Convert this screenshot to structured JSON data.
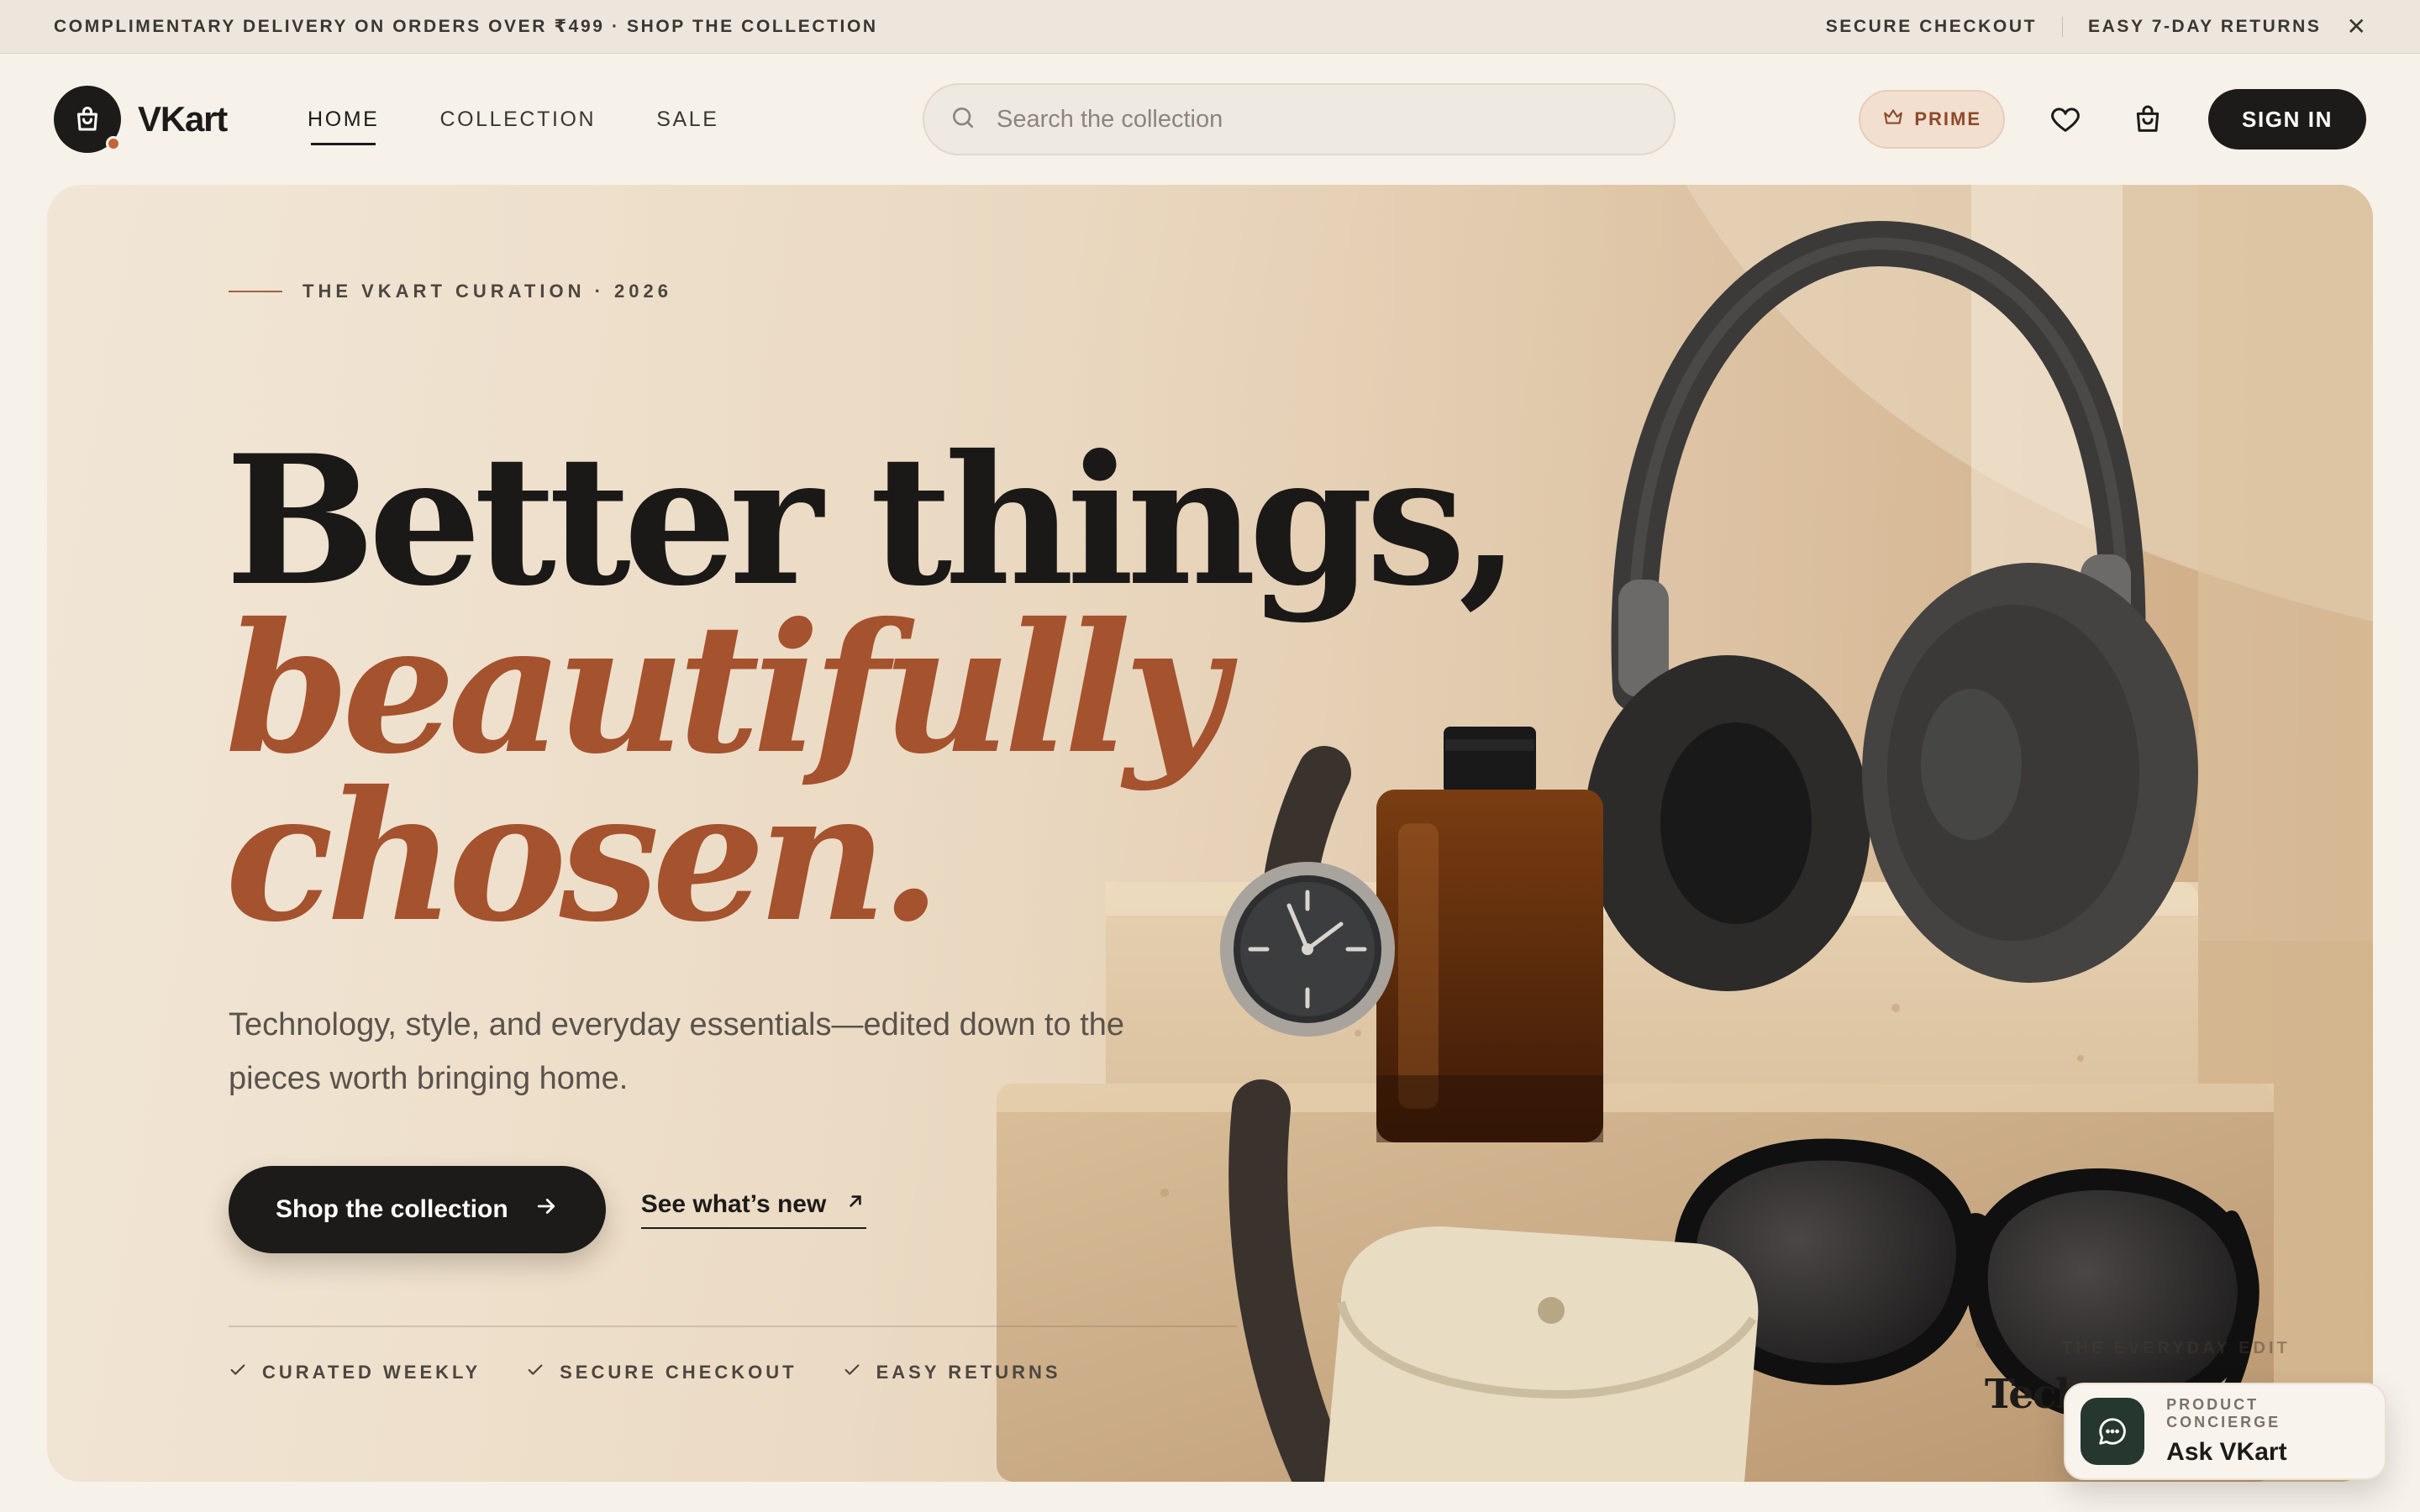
{
  "announcement": {
    "left_text": "COMPLIMENTARY DELIVERY ON ORDERS OVER ₹499 · SHOP THE COLLECTION",
    "secure_checkout": "SECURE CHECKOUT",
    "returns": "EASY 7-DAY RETURNS",
    "close_icon": "close-icon"
  },
  "header": {
    "brand_name": "VKart",
    "nav": [
      {
        "label": "HOME",
        "active": true
      },
      {
        "label": "COLLECTION",
        "active": false
      },
      {
        "label": "SALE",
        "active": false
      }
    ],
    "search": {
      "placeholder": "Search the collection",
      "icon": "search-icon"
    },
    "prime_label": "PRIME",
    "prime_icon": "crown-icon",
    "wishlist_icon": "heart-icon",
    "cart_icon": "shopping-bag-icon",
    "signin_label": "SIGN IN"
  },
  "hero": {
    "eyebrow": "THE VKART CURATION · 2026",
    "headline_line1": "Better things,",
    "headline_line2": "beautifully",
    "headline_line3": "chosen.",
    "subcopy": "Technology, style, and everyday essentials—edited down to the pieces worth bringing home.",
    "cta_primary": "Shop the collection",
    "cta_secondary": "See what’s new",
    "trust": [
      "CURATED WEEKLY",
      "SECURE CHECKOUT",
      "EASY RETURNS"
    ],
    "everyday_label": "THE EVERYDAY EDIT",
    "tech_label": "Tech"
  },
  "concierge": {
    "label": "PRODUCT CONCIERGE",
    "title": "Ask VKart",
    "icon": "chat-bubble-icon"
  },
  "colors": {
    "accent": "#a5522e",
    "dark": "#1d1b19",
    "background": "#f6f2ea",
    "concierge_icon_bg": "#25372f"
  }
}
